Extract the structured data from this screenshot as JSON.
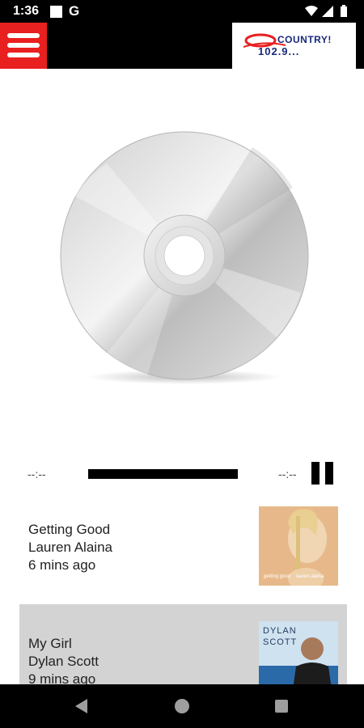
{
  "status_bar": {
    "time": "1:36",
    "carrier_letter": "G"
  },
  "header": {
    "menu_icon": "hamburger-menu-icon",
    "logo_text": "COUNTRY!",
    "logo_frequency": "102.9..."
  },
  "player": {
    "elapsed": "--:--",
    "remaining": "--:--",
    "pause_icon": "pause-icon"
  },
  "tracks": [
    {
      "title": "Getting Good",
      "artist": "Lauren Alaina",
      "time_ago": "6 mins ago",
      "cover_caption_1": "getting good",
      "cover_caption_2": "lauren alaina"
    },
    {
      "title": "My Girl",
      "artist": "Dylan Scott",
      "time_ago": "9 mins ago",
      "cover_title_1": "DYLAN",
      "cover_title_2": "SCOTT"
    }
  ],
  "colors": {
    "menu_red": "#e8201f",
    "logo_blue": "#1b2a7a",
    "highlight_row": "#d3d3d3"
  }
}
